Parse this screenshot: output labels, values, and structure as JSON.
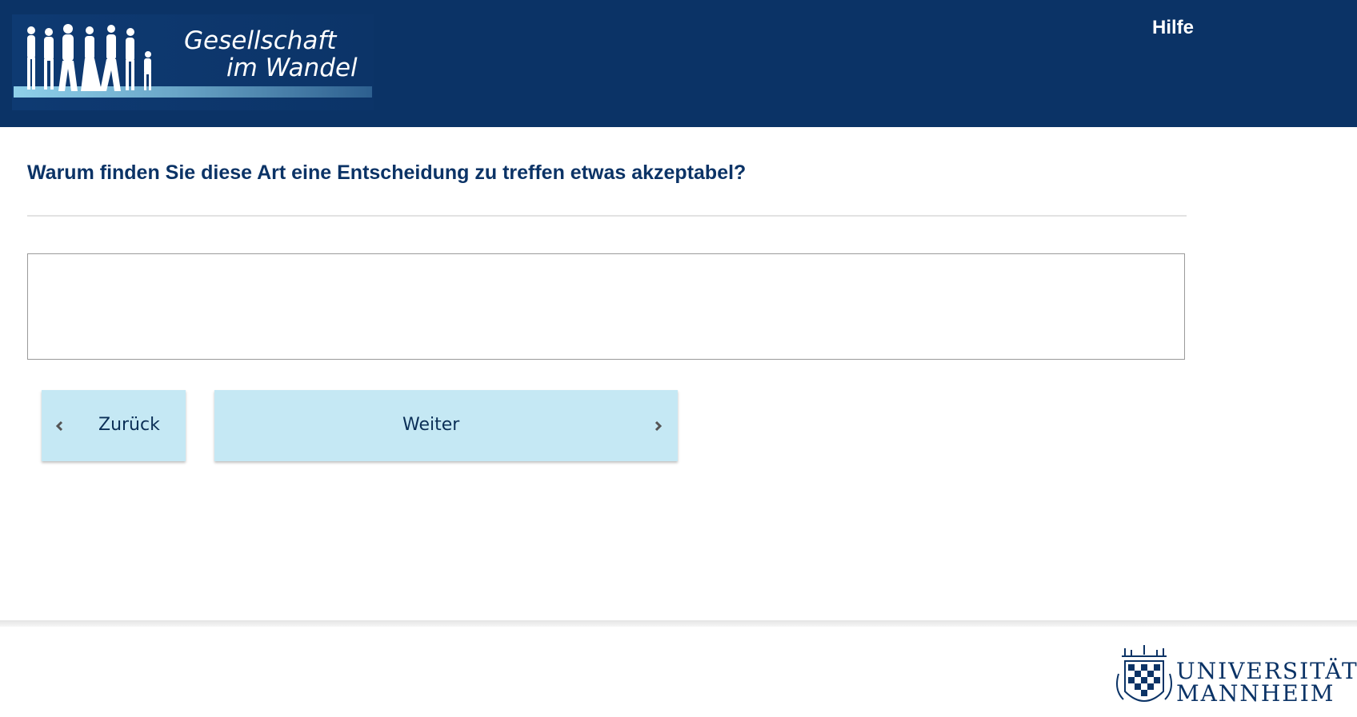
{
  "header": {
    "logo_line1": "Gesellschaft",
    "logo_line2": "im Wandel",
    "help_link": "Hilfe"
  },
  "question": {
    "text": "Warum finden Sie diese Art eine Entscheidung zu treffen etwas akzeptabel?",
    "answer_value": ""
  },
  "navigation": {
    "back_label": "Zurück",
    "next_label": "Weiter"
  },
  "footer": {
    "university_line1": "UNIVERSITÄT",
    "university_line2": "MANNHEIM"
  },
  "colors": {
    "header_bg": "#0b3366",
    "button_bg": "#c5e8f4",
    "question_text": "#0b3366"
  }
}
